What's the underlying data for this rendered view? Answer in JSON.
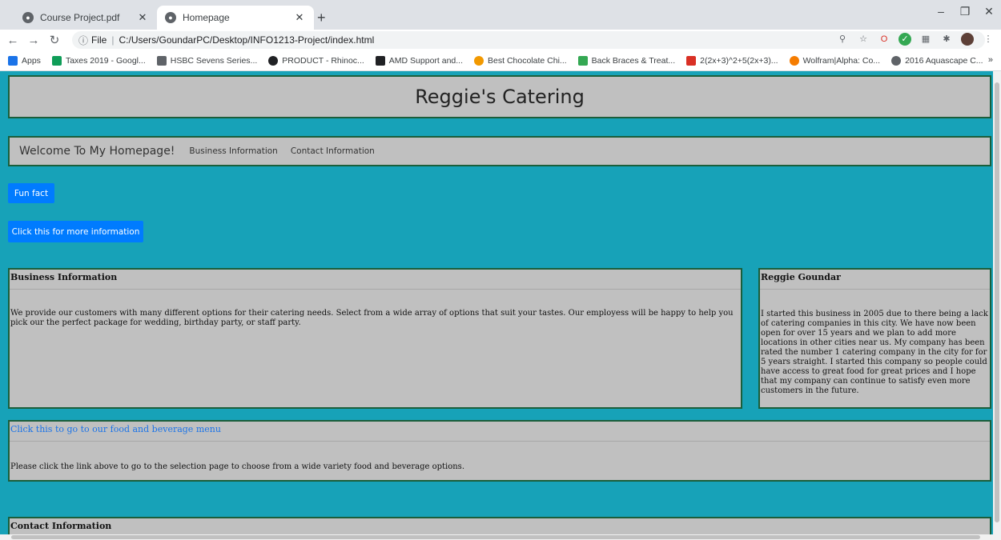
{
  "browser": {
    "tabs": [
      {
        "title": "Course Project.pdf",
        "active": false
      },
      {
        "title": "Homepage",
        "active": true
      }
    ],
    "address": {
      "info_label": "File",
      "url": "C:/Users/GoundarPC/Desktop/INFO1213-Project/index.html"
    },
    "bookmarks": [
      {
        "label": "Apps",
        "color": "#1a73e8"
      },
      {
        "label": "Taxes 2019 - Googl...",
        "color": "#0f9d58"
      },
      {
        "label": "HSBC Sevens Series...",
        "color": "#5f6368"
      },
      {
        "label": "PRODUCT - Rhinoc...",
        "color": "#202124"
      },
      {
        "label": "AMD Support and...",
        "color": "#202124"
      },
      {
        "label": "Best Chocolate Chi...",
        "color": "#f29900"
      },
      {
        "label": "Back Braces & Treat...",
        "color": "#34a853"
      },
      {
        "label": "2(2x+3)^2+5(2x+3)...",
        "color": "#d93025"
      },
      {
        "label": "Wolfram|Alpha: Co...",
        "color": "#f57c00"
      },
      {
        "label": "2016 Aquascape C...",
        "color": "#5f6368"
      }
    ],
    "bookmarks_more": "»"
  },
  "site": {
    "title": "Reggie's Catering",
    "nav": {
      "brand": "Welcome To My Homepage!",
      "links": [
        "Business Information",
        "Contact Information"
      ]
    },
    "buttons": {
      "fun_fact": "Fun fact",
      "more_info": "Click this for more information"
    },
    "business": {
      "heading": "Business Information",
      "body": "We provide our customers with many different options for their catering needs. Select from a wide array of options that suit your tastes. Our employess will be happy to help you pick our the perfect package for wedding, birthday party, or staff party."
    },
    "owner": {
      "heading": "Reggie Goundar",
      "body": "I started this business in 2005 due to there being a lack of catering companies in this city. We have now been open for over 15 years and we plan to add more locations in other cities near us. My company has been rated the number 1 catering company in the city for for 5 years straight. I started this company so people could have access to great food for great prices and I hope that my company can continue to satisfy even more customers in the future."
    },
    "menu": {
      "link": "Click this to go to our food and beverage menu",
      "body": "Please click the link above to go to the selection page to choose from a wide variety food and beverage options."
    },
    "contact": {
      "heading": "Contact Information"
    }
  },
  "colors": {
    "page_bg": "#17a2b8",
    "panel_bg": "#c0c0c0",
    "panel_border": "#1b5e3b",
    "button": "#007bff"
  }
}
